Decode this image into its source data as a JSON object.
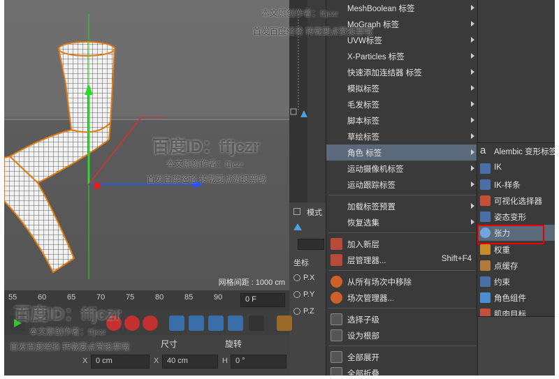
{
  "viewport": {
    "grid_spacing": "网格间距 : 1000 cm"
  },
  "timeline": {
    "ticks": [
      "55",
      "60",
      "65",
      "70",
      "75",
      "80",
      "85",
      "90"
    ],
    "frame_field": "0 F"
  },
  "coords": {
    "size_label": "尺寸",
    "rotation_label": "旋转",
    "x_label": "X",
    "x_value": "0 cm",
    "x2_label": "X",
    "x2_value": "40 cm",
    "h_label": "H",
    "h_value": "0 °"
  },
  "attributes": {
    "coord_label": "坐标",
    "rows": [
      "P.X",
      "P.Y",
      "P.Z"
    ],
    "mode_label": "模式"
  },
  "tag_menu": {
    "items": [
      {
        "label": "MeshBoolean 标签",
        "arrow": true
      },
      {
        "label": "MoGraph 标签",
        "arrow": true
      },
      {
        "label": "UVW标签",
        "arrow": true
      },
      {
        "label": "X-Particles 标签",
        "arrow": true
      },
      {
        "label": "快速添加连结器 标签",
        "arrow": true
      },
      {
        "label": "模拟标签",
        "arrow": true
      },
      {
        "label": "毛发标签",
        "arrow": true
      },
      {
        "label": "脚本标签",
        "arrow": true
      },
      {
        "label": "草绘标签",
        "arrow": true
      },
      {
        "label": "角色 标签",
        "arrow": true,
        "highlight": true
      },
      {
        "label": "运动摄像机标签",
        "arrow": true
      },
      {
        "label": "运动跟踪标签",
        "arrow": true
      }
    ],
    "preset_items": [
      {
        "label": "加载标签预置",
        "arrow": true
      },
      {
        "label": "恢复选集",
        "arrow": true
      }
    ],
    "layer_items": [
      {
        "label": "加入新层",
        "shortcut": ""
      },
      {
        "label": "层管理器...",
        "shortcut": "Shift+F4"
      }
    ],
    "take_items": [
      {
        "label": "从所有场次中移除"
      },
      {
        "label": "场次管理器..."
      }
    ],
    "select_items": [
      {
        "label": "选择子级"
      },
      {
        "label": "设为根部"
      }
    ],
    "fold_items": [
      {
        "label": "全部展开"
      },
      {
        "label": "全部折叠"
      }
    ]
  },
  "character_submenu": {
    "items": [
      {
        "label": "Alembic 变形标签",
        "icon": "alembic-icon"
      },
      {
        "label": "IK",
        "icon": "ik-icon"
      },
      {
        "label": "IK-样条",
        "icon": "ik-spline-icon"
      },
      {
        "label": "可视化选择器",
        "icon": "visual-selector-icon"
      },
      {
        "label": "姿态变形",
        "icon": "pose-morph-icon"
      },
      {
        "label": "张力",
        "icon": "tension-icon",
        "highlight": true
      },
      {
        "label": "权重",
        "icon": "weight-icon"
      },
      {
        "label": "点缓存",
        "icon": "point-cache-icon"
      },
      {
        "label": "约束",
        "icon": "constraint-icon"
      },
      {
        "label": "角色组件",
        "icon": "character-component-icon"
      },
      {
        "label": "肌肉目标",
        "icon": "muscle-target-icon"
      }
    ]
  },
  "watermark": {
    "big": "百度ID：ffjczr",
    "line1": "本文原创作者：ffjczr",
    "line2": "首发百度经验 转载要点赞投票哦"
  }
}
